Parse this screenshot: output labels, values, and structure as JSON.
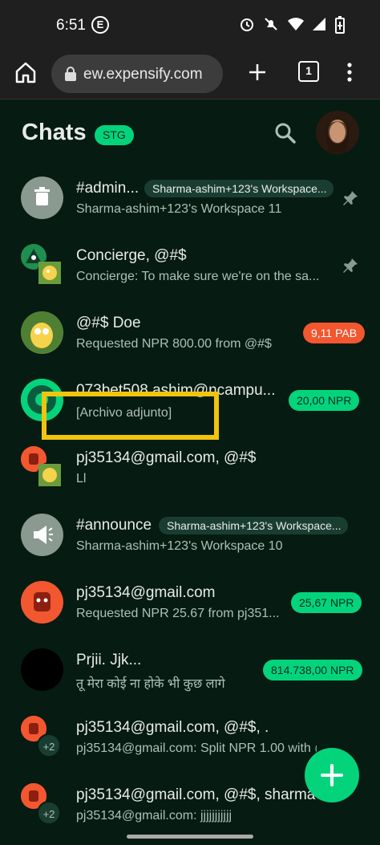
{
  "status_bar": {
    "time": "6:51",
    "badge": "E"
  },
  "browser": {
    "url": "ew.expensify.com",
    "tab_count": "1"
  },
  "header": {
    "title": "Chats",
    "env_badge": "STG"
  },
  "chats": [
    {
      "name": "#admin...",
      "workspace_chip": "Sharma-ashim+123's Workspace...",
      "preview": "Sharma-ashim+123's Workspace 11",
      "pinned": true
    },
    {
      "name": "Concierge, @#$",
      "preview": "Concierge: To make sure we're on the sa...",
      "pinned": true
    },
    {
      "name": "@#$ Doe",
      "preview": "Requested NPR 800.00 from @#$",
      "badge": "9,11 PAB"
    },
    {
      "name": "073bet508.ashim@ncampu...",
      "preview": "[Archivo adjunto]",
      "badge": "20,00 NPR"
    },
    {
      "name": "pj35134@gmail.com, @#$",
      "preview": "Ll"
    },
    {
      "name": "#announce",
      "workspace_chip": "Sharma-ashim+123's Workspace...",
      "preview": "Sharma-ashim+123's Workspace 10"
    },
    {
      "name": "pj35134@gmail.com",
      "preview": "Requested NPR 25.67 from pj351...",
      "badge": "25,67 NPR"
    },
    {
      "name": "Prjii.                    Jjk...",
      "preview": "तू मेरा कोई ना होके भी कुछ लागे",
      "badge": "814.738,00 NPR"
    },
    {
      "name": "pj35134@gmail.com, @#$, .",
      "preview": "pj35134@gmail.com: Split NPR 1.00 with @",
      "extra": "+2"
    },
    {
      "name": "pj35134@gmail.com, @#$, sharma",
      "preview": "pj35134@gmail.com: jjjjjjjjjjj",
      "extra": "+2"
    }
  ],
  "colors": {
    "background": "#061b12",
    "accent": "#03d47c",
    "danger": "#f25730",
    "highlight": "#f1c40f"
  },
  "icons": [
    "home-icon",
    "lock-icon",
    "plus-icon",
    "tabs-icon",
    "more-vert-icon",
    "search-icon",
    "trash-icon",
    "pin-icon",
    "megaphone-icon",
    "fab-plus-icon"
  ]
}
